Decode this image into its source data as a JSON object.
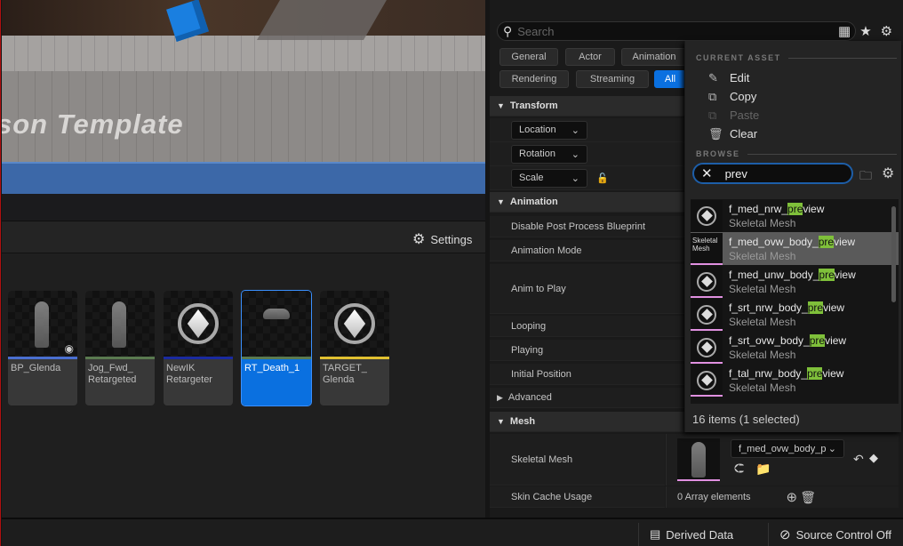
{
  "viewport": {
    "template_text": "son Template"
  },
  "content_browser": {
    "settings_label": "Settings",
    "assets": [
      {
        "name": "BP_Glenda",
        "bar_color": "#4a6fd0",
        "selected": false
      },
      {
        "name": "Jog_Fwd_ Retargeted",
        "bar_color": "#5a7a50",
        "selected": false
      },
      {
        "name": "NewIK Retargeter",
        "bar_color": "#1a2aa0",
        "selected": false
      },
      {
        "name": "RT_Death_1",
        "bar_color": "#5a7a50",
        "selected": true
      },
      {
        "name": "TARGET_ Glenda",
        "bar_color": "#e0c030",
        "selected": false
      }
    ]
  },
  "details": {
    "search_placeholder": "Search",
    "filters": [
      "General",
      "Actor",
      "Animation",
      "Rendering",
      "Streaming",
      "All"
    ],
    "active_filter": "All",
    "sections": {
      "transform": "Transform",
      "animation": "Animation",
      "advanced": "Advanced",
      "mesh": "Mesh"
    },
    "transform": {
      "location": "Location",
      "rotation": "Rotation",
      "scale": "Scale"
    },
    "animation_props": [
      "Disable Post Process Blueprint",
      "Animation Mode",
      "Anim to Play",
      "Looping",
      "Playing",
      "Initial Position"
    ],
    "mesh": {
      "skeletal_mesh_label": "Skeletal Mesh",
      "skeletal_mesh_value": "f_med_ovw_body_p",
      "skin_cache_label": "Skin Cache Usage",
      "skin_cache_value": "0 Array elements"
    }
  },
  "popup": {
    "current_asset_title": "CURRENT ASSET",
    "actions": [
      {
        "label": "Edit",
        "enabled": true
      },
      {
        "label": "Copy",
        "enabled": true
      },
      {
        "label": "Paste",
        "enabled": false
      },
      {
        "label": "Clear",
        "enabled": true
      }
    ],
    "browse_title": "BROWSE",
    "search_value": "prev",
    "highlight": "pre",
    "items": [
      {
        "pre": "f_med_nrw_",
        "post": "view",
        "type": "Skeletal Mesh",
        "selected": false
      },
      {
        "pre": "f_med_ovw_body_",
        "post": "view",
        "type": "Skeletal Mesh",
        "selected": true
      },
      {
        "pre": "f_med_unw_body_",
        "post": "view",
        "type": "Skeletal Mesh",
        "selected": false
      },
      {
        "pre": "f_srt_nrw_body_",
        "post": "view",
        "type": "Skeletal Mesh",
        "selected": false
      },
      {
        "pre": "f_srt_ovw_body_",
        "post": "view",
        "type": "Skeletal Mesh",
        "selected": false
      },
      {
        "pre": "f_tal_nrw_body_",
        "post": "view",
        "type": "Skeletal Mesh",
        "selected": false
      }
    ],
    "thumb_overlay": "Skeletal Mesh",
    "count_text": "16 items (1 selected)"
  },
  "status": {
    "derived_data": "Derived Data",
    "source_control": "Source Control Off"
  }
}
